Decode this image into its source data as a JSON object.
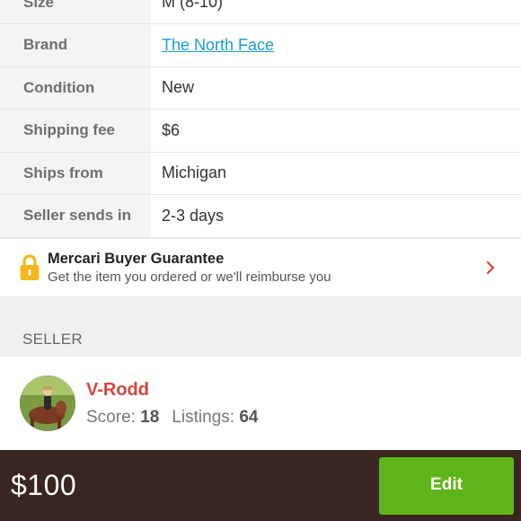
{
  "details": [
    {
      "key": "size",
      "label": "Size",
      "value": "M (8-10)",
      "is_link": false
    },
    {
      "key": "brand",
      "label": "Brand",
      "value": "The North Face",
      "is_link": true
    },
    {
      "key": "condition",
      "label": "Condition",
      "value": "New",
      "is_link": false
    },
    {
      "key": "shipping_fee",
      "label": "Shipping fee",
      "value": "$6",
      "is_link": false
    },
    {
      "key": "ships_from",
      "label": "Ships from",
      "value": "Michigan",
      "is_link": false
    },
    {
      "key": "seller_sends_in",
      "label": "Seller sends in",
      "value": "2-3 days",
      "is_link": false
    }
  ],
  "guarantee": {
    "icon": "lock-icon",
    "title": "Mercari Buyer Guarantee",
    "subtitle": "Get the item you ordered or we'll reimburse you",
    "chevron_icon": "chevron-right-icon"
  },
  "seller_section": {
    "header": "SELLER",
    "name": "V-Rodd",
    "score_label": "Score:",
    "score": "18",
    "listings_label": "Listings:",
    "listings": "64"
  },
  "bottom_bar": {
    "price": "$100",
    "edit_label": "Edit"
  },
  "colors": {
    "link": "#1a9bd7",
    "seller_name": "#d4453c",
    "chevron": "#e0413a",
    "lock": "#f5b81c",
    "edit_button": "#5fb41a",
    "bottom_bar": "#3a2520"
  }
}
